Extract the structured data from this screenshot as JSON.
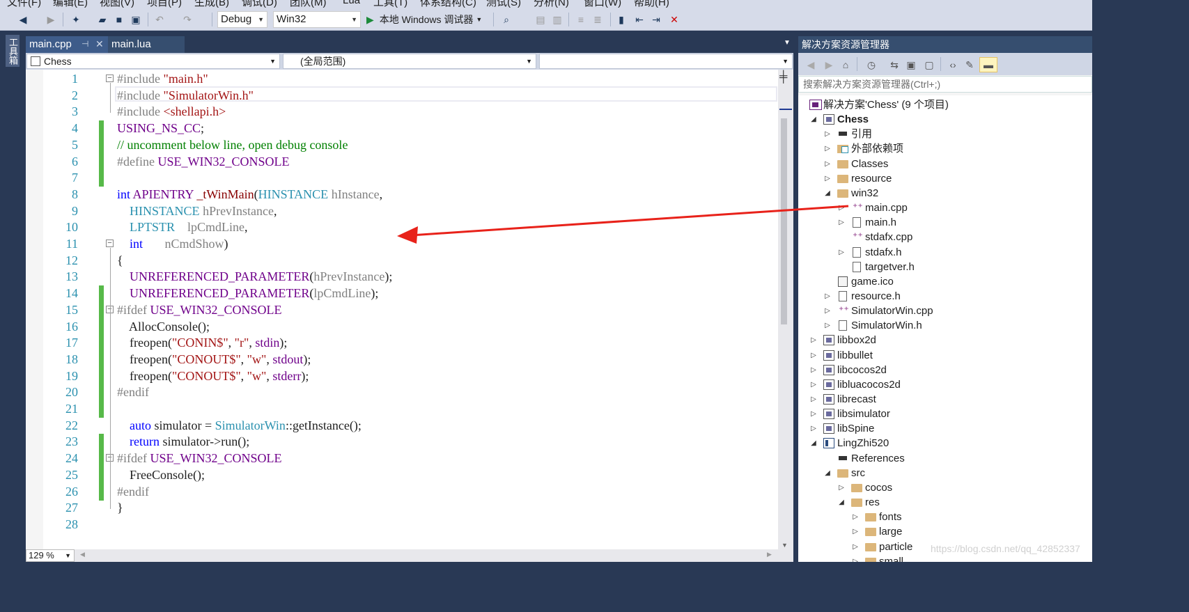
{
  "menu": [
    "文件(F)",
    "编辑(E)",
    "视图(V)",
    "项目(P)",
    "生成(B)",
    "调试(D)",
    "团队(M)",
    "Lua",
    "工具(T)",
    "体系结构(C)",
    "测试(S)",
    "分析(N)",
    "窗口(W)",
    "帮助(H)"
  ],
  "toolbar": {
    "config": "Debug",
    "platform": "Win32",
    "run_label": "本地 Windows 调试器"
  },
  "toolbox": {
    "label": "工具箱"
  },
  "tabs": [
    {
      "label": "main.cpp",
      "active": true
    },
    {
      "label": "main.lua",
      "active": false
    }
  ],
  "nav": {
    "project": "Chess",
    "scope": "(全局范围)",
    "member": ""
  },
  "code_lines": [
    {
      "n": "1",
      "parts": [
        [
          "pp",
          "#include "
        ],
        [
          "str",
          "\"main.h\""
        ]
      ]
    },
    {
      "n": "2",
      "parts": [
        [
          "pp",
          "#include "
        ],
        [
          "str",
          "\"SimulatorWin.h\""
        ]
      ]
    },
    {
      "n": "3",
      "parts": [
        [
          "pp",
          "#include "
        ],
        [
          "str",
          "<shellapi.h>"
        ]
      ]
    },
    {
      "n": "4",
      "parts": [
        [
          "mac",
          "USING_NS_CC"
        ],
        [
          "pl",
          ";"
        ]
      ]
    },
    {
      "n": "5",
      "parts": [
        [
          "cm",
          "// uncomment below line, open debug console"
        ]
      ]
    },
    {
      "n": "6",
      "parts": [
        [
          "pp",
          "#define "
        ],
        [
          "mac",
          "USE_WIN32_CONSOLE"
        ]
      ]
    },
    {
      "n": "7",
      "parts": []
    },
    {
      "n": "8",
      "parts": [
        [
          "kw",
          "int "
        ],
        [
          "mac",
          "APIENTRY "
        ],
        [
          "fn",
          "_tWinMain"
        ],
        [
          "pl",
          "("
        ],
        [
          "ty",
          "HINSTANCE "
        ],
        [
          "pp",
          "hInstance"
        ],
        [
          "pl",
          ","
        ]
      ]
    },
    {
      "n": "9",
      "parts": [
        [
          "pl",
          "    "
        ],
        [
          "ty",
          "HINSTANCE "
        ],
        [
          "pp",
          "hPrevInstance"
        ],
        [
          "pl",
          ","
        ]
      ]
    },
    {
      "n": "10",
      "parts": [
        [
          "pl",
          "    "
        ],
        [
          "ty",
          "LPTSTR    "
        ],
        [
          "pp",
          "lpCmdLine"
        ],
        [
          "pl",
          ","
        ]
      ]
    },
    {
      "n": "11",
      "parts": [
        [
          "pl",
          "    "
        ],
        [
          "kw",
          "int       "
        ],
        [
          "pp",
          "nCmdShow"
        ],
        [
          "pl",
          ")"
        ]
      ]
    },
    {
      "n": "12",
      "parts": [
        [
          "pl",
          "{"
        ]
      ]
    },
    {
      "n": "13",
      "parts": [
        [
          "pl",
          "    "
        ],
        [
          "mac",
          "UNREFERENCED_PARAMETER"
        ],
        [
          "pl",
          "("
        ],
        [
          "pp",
          "hPrevInstance"
        ],
        [
          "pl",
          ");"
        ]
      ]
    },
    {
      "n": "14",
      "parts": [
        [
          "pl",
          "    "
        ],
        [
          "mac",
          "UNREFERENCED_PARAMETER"
        ],
        [
          "pl",
          "("
        ],
        [
          "pp",
          "lpCmdLine"
        ],
        [
          "pl",
          ");"
        ]
      ]
    },
    {
      "n": "15",
      "parts": [
        [
          "pp",
          "#ifdef "
        ],
        [
          "mac",
          "USE_WIN32_CONSOLE"
        ]
      ]
    },
    {
      "n": "16",
      "parts": [
        [
          "pl",
          "    AllocConsole();"
        ]
      ]
    },
    {
      "n": "17",
      "parts": [
        [
          "pl",
          "    freopen("
        ],
        [
          "str",
          "\"CONIN$\""
        ],
        [
          "pl",
          ", "
        ],
        [
          "str",
          "\"r\""
        ],
        [
          "pl",
          ", "
        ],
        [
          "mac",
          "stdin"
        ],
        [
          "pl",
          ");"
        ]
      ]
    },
    {
      "n": "18",
      "parts": [
        [
          "pl",
          "    freopen("
        ],
        [
          "str",
          "\"CONOUT$\""
        ],
        [
          "pl",
          ", "
        ],
        [
          "str",
          "\"w\""
        ],
        [
          "pl",
          ", "
        ],
        [
          "mac",
          "stdout"
        ],
        [
          "pl",
          ");"
        ]
      ]
    },
    {
      "n": "19",
      "parts": [
        [
          "pl",
          "    freopen("
        ],
        [
          "str",
          "\"CONOUT$\""
        ],
        [
          "pl",
          ", "
        ],
        [
          "str",
          "\"w\""
        ],
        [
          "pl",
          ", "
        ],
        [
          "mac",
          "stderr"
        ],
        [
          "pl",
          ");"
        ]
      ]
    },
    {
      "n": "20",
      "parts": [
        [
          "pp",
          "#endif"
        ]
      ]
    },
    {
      "n": "21",
      "parts": []
    },
    {
      "n": "22",
      "parts": [
        [
          "pl",
          "    "
        ],
        [
          "kw",
          "auto "
        ],
        [
          "pl",
          "simulator = "
        ],
        [
          "ty",
          "SimulatorWin"
        ],
        [
          "pl",
          "::getInstance();"
        ]
      ]
    },
    {
      "n": "23",
      "parts": [
        [
          "pl",
          "    "
        ],
        [
          "kw",
          "return "
        ],
        [
          "pl",
          "simulator->run();"
        ]
      ]
    },
    {
      "n": "24",
      "parts": [
        [
          "pp",
          "#ifdef "
        ],
        [
          "mac",
          "USE_WIN32_CONSOLE"
        ]
      ]
    },
    {
      "n": "25",
      "parts": [
        [
          "pl",
          "    FreeConsole();"
        ]
      ]
    },
    {
      "n": "26",
      "parts": [
        [
          "pp",
          "#endif"
        ]
      ]
    },
    {
      "n": "27",
      "parts": [
        [
          "pl",
          "}"
        ]
      ]
    },
    {
      "n": "28",
      "parts": []
    }
  ],
  "editor": {
    "zoom": "129 %"
  },
  "solution_explorer": {
    "title": "解决方案资源管理器",
    "search_placeholder": "搜索解决方案资源管理器(Ctrl+;)",
    "nodes": [
      {
        "label": "解决方案'Chess' (9 个项目)",
        "icon": "solution-icon",
        "depth": 0,
        "exp": ""
      },
      {
        "label": "Chess",
        "icon": "project-icon",
        "depth": 1,
        "exp": "open",
        "bold": true
      },
      {
        "label": "引用",
        "icon": "references-icon",
        "depth": 2,
        "exp": "closed"
      },
      {
        "label": "外部依赖项",
        "icon": "external-deps-icon",
        "depth": 2,
        "exp": "closed"
      },
      {
        "label": "Classes",
        "icon": "folder-icon",
        "depth": 2,
        "exp": "closed"
      },
      {
        "label": "resource",
        "icon": "folder-icon",
        "depth": 2,
        "exp": "closed"
      },
      {
        "label": "win32",
        "icon": "folder-icon",
        "depth": 2,
        "exp": "open"
      },
      {
        "label": "main.cpp",
        "icon": "cpp-file-icon",
        "depth": 3,
        "exp": "closed"
      },
      {
        "label": "main.h",
        "icon": "header-file-icon",
        "depth": 3,
        "exp": "closed"
      },
      {
        "label": "stdafx.cpp",
        "icon": "cpp-file-icon",
        "depth": 3,
        "exp": ""
      },
      {
        "label": "stdafx.h",
        "icon": "header-file-icon",
        "depth": 3,
        "exp": "closed"
      },
      {
        "label": "targetver.h",
        "icon": "header-file-icon",
        "depth": 3,
        "exp": ""
      },
      {
        "label": "game.ico",
        "icon": "image-file-icon",
        "depth": 2,
        "exp": ""
      },
      {
        "label": "resource.h",
        "icon": "header-file-icon",
        "depth": 2,
        "exp": "closed"
      },
      {
        "label": "SimulatorWin.cpp",
        "icon": "cpp-file-icon",
        "depth": 2,
        "exp": "closed"
      },
      {
        "label": "SimulatorWin.h",
        "icon": "header-file-icon",
        "depth": 2,
        "exp": "closed"
      },
      {
        "label": "libbox2d",
        "icon": "project-icon",
        "depth": 1,
        "exp": "closed"
      },
      {
        "label": "libbullet",
        "icon": "project-icon",
        "depth": 1,
        "exp": "closed"
      },
      {
        "label": "libcocos2d",
        "icon": "project-icon",
        "depth": 1,
        "exp": "closed"
      },
      {
        "label": "libluacocos2d",
        "icon": "project-icon",
        "depth": 1,
        "exp": "closed"
      },
      {
        "label": "librecast",
        "icon": "project-icon",
        "depth": 1,
        "exp": "closed"
      },
      {
        "label": "libsimulator",
        "icon": "project-icon",
        "depth": 1,
        "exp": "closed"
      },
      {
        "label": "libSpine",
        "icon": "project-icon",
        "depth": 1,
        "exp": "closed"
      },
      {
        "label": "LingZhi520",
        "icon": "lua-project-icon",
        "depth": 1,
        "exp": "open"
      },
      {
        "label": "References",
        "icon": "references-icon",
        "depth": 2,
        "exp": ""
      },
      {
        "label": "src",
        "icon": "folder-icon",
        "depth": 2,
        "exp": "open"
      },
      {
        "label": "cocos",
        "icon": "folder-icon",
        "depth": 3,
        "exp": "closed"
      },
      {
        "label": "res",
        "icon": "folder-icon",
        "depth": 3,
        "exp": "open"
      },
      {
        "label": "fonts",
        "icon": "folder-icon",
        "depth": 4,
        "exp": "closed"
      },
      {
        "label": "large",
        "icon": "folder-icon",
        "depth": 4,
        "exp": "closed"
      },
      {
        "label": "particle",
        "icon": "folder-icon",
        "depth": 4,
        "exp": "closed"
      },
      {
        "label": "small",
        "icon": "folder-icon",
        "depth": 4,
        "exp": "closed"
      }
    ],
    "watermark": "https://blog.csdn.net/qq_42852337"
  },
  "colors": {
    "accent": "#293955",
    "annotation_arrow": "#e8221a",
    "change_bar": "#57b949"
  }
}
